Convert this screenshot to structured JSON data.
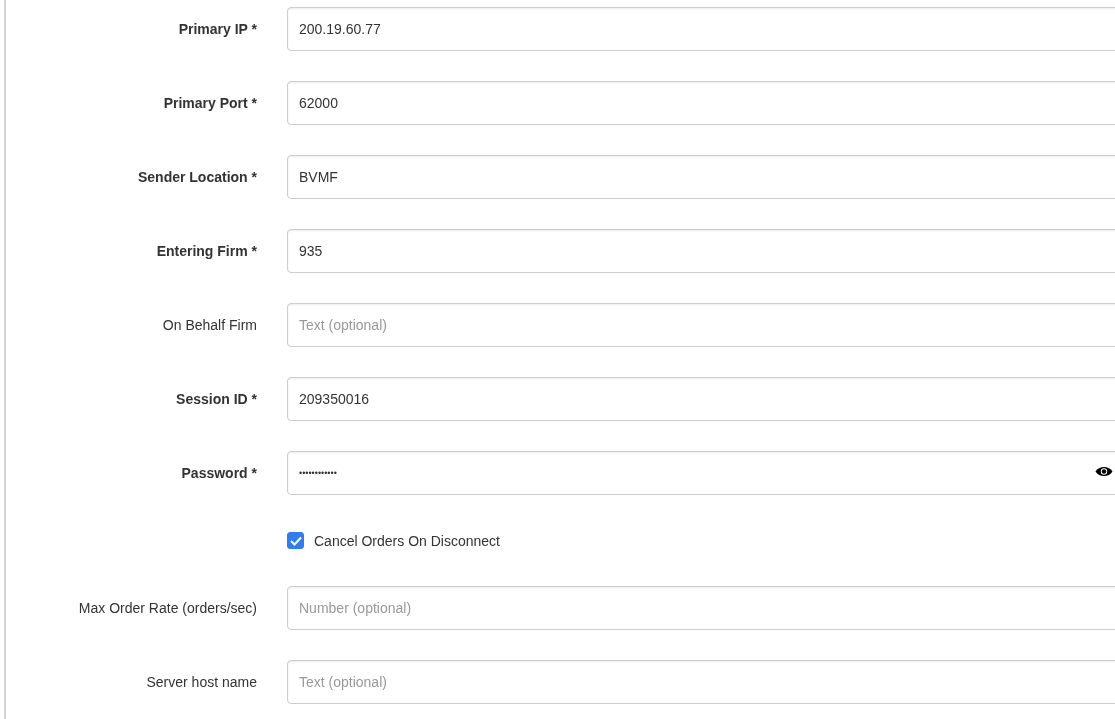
{
  "fields": [
    {
      "kind": "text",
      "label": "Primary IP *",
      "required": true,
      "value": "200.19.60.77"
    },
    {
      "kind": "text",
      "label": "Primary Port *",
      "required": true,
      "value": "62000"
    },
    {
      "kind": "text",
      "label": "Sender Location *",
      "required": true,
      "value": "BVMF"
    },
    {
      "kind": "text",
      "label": "Entering Firm *",
      "required": true,
      "value": "935"
    },
    {
      "kind": "text",
      "label": "On Behalf Firm",
      "required": false,
      "placeholder": "Text (optional)"
    },
    {
      "kind": "text",
      "label": "Session ID *",
      "required": true,
      "value": "209350016"
    },
    {
      "kind": "password",
      "label": "Password *",
      "required": true,
      "value": "••••••••••••"
    },
    {
      "kind": "checkbox",
      "label": "Cancel Orders On Disconnect",
      "checked": true
    },
    {
      "kind": "text",
      "label": "Max Order Rate (orders/sec)",
      "required": false,
      "placeholder": "Number (optional)"
    },
    {
      "kind": "text",
      "label": "Server host name",
      "required": false,
      "placeholder": "Text (optional)"
    }
  ]
}
